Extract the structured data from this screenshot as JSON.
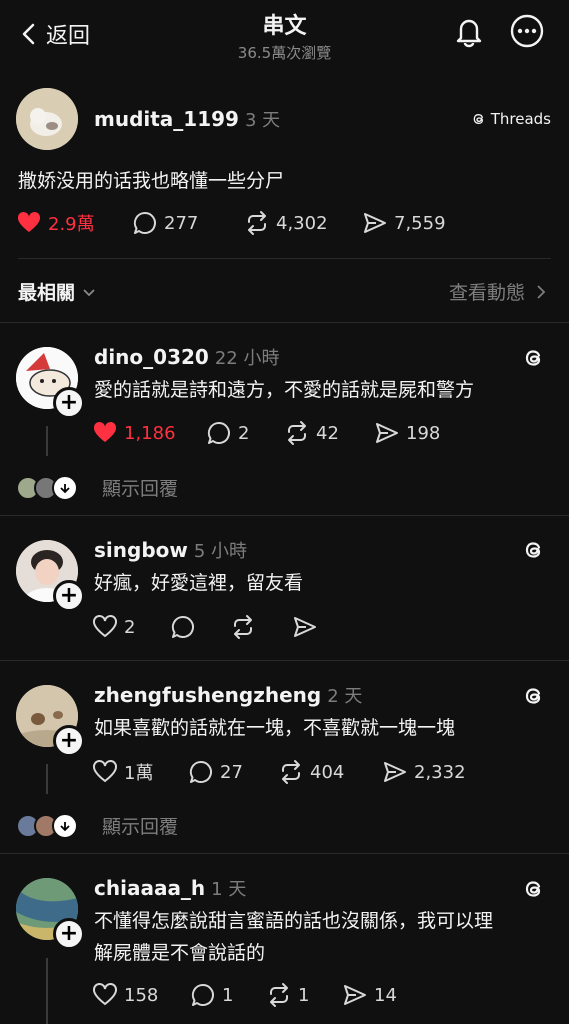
{
  "header": {
    "back_label": "返回",
    "title": "串文",
    "views": "36.5萬次瀏覽"
  },
  "main_post": {
    "username": "mudita_1199",
    "time": "3 天",
    "threads_label": "Threads",
    "text": "撒娇没用的话我也略懂一些分尸",
    "likes": "2.9萬",
    "comments": "277",
    "reposts": "4,302",
    "shares": "7,559"
  },
  "sort": {
    "label": "最相關",
    "activity_label": "查看動態"
  },
  "replies": [
    {
      "username": "dino_0320",
      "time": "22 小時",
      "text": "愛的話就是詩和遠方，不愛的話就是屍和警方",
      "likes": "1,186",
      "comments": "2",
      "reposts": "42",
      "shares": "198",
      "show_replies": "顯示回覆"
    },
    {
      "username": "singbow",
      "time": "5 小時",
      "text": "好瘋，好愛這裡，留友看",
      "likes": "2",
      "comments": "",
      "reposts": "",
      "shares": ""
    },
    {
      "username": "zhengfushengzheng",
      "time": "2 天",
      "text": "如果喜歡的話就在一塊，不喜歡就一塊一塊",
      "likes": "1萬",
      "comments": "27",
      "reposts": "404",
      "shares": "2,332",
      "show_replies": "顯示回覆"
    },
    {
      "username": "chiaaaa_h",
      "time": "1 天",
      "text_line1": "不懂得怎麼說甜言蜜語的話也沒關係，我可以理",
      "text_line2": "解屍體是不會說話的",
      "likes": "158",
      "comments": "1",
      "reposts": "1",
      "shares": "14"
    }
  ],
  "colors": {
    "background": "#101010",
    "like_red": "#ff3040",
    "muted": "#7d7d7d"
  }
}
